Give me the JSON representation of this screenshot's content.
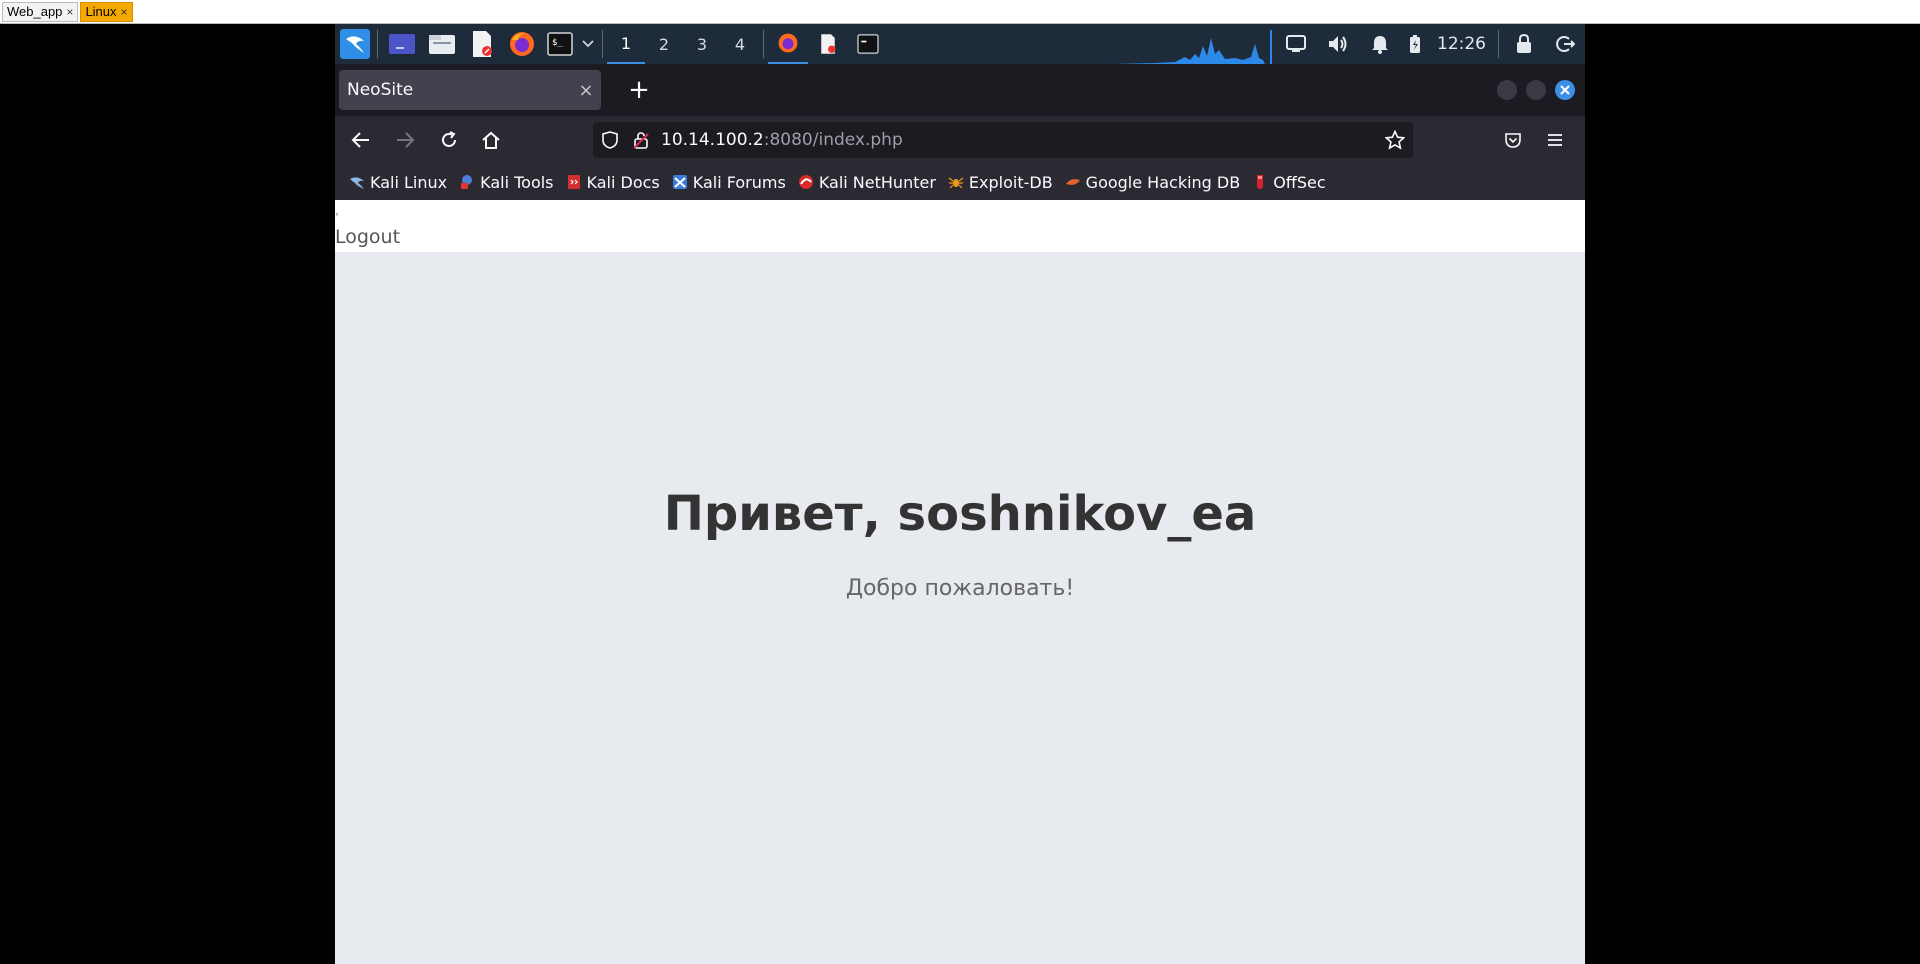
{
  "outer_tabs": [
    {
      "label": "Web_app",
      "close": "×"
    },
    {
      "label": "Linux",
      "close": "×"
    }
  ],
  "panel": {
    "workspaces": [
      "1",
      "2",
      "3",
      "4"
    ],
    "active_workspace": "1",
    "clock": "12:26",
    "icons": [
      "kali-menu-icon",
      "terminal-launcher-icon",
      "file-manager-icon",
      "text-editor-icon",
      "firefox-icon",
      "terminal-icon",
      "chevron-down-icon",
      "firefox-window-icon",
      "editor-window-icon",
      "terminal-window-icon",
      "network-monitor-icon",
      "display-icon",
      "volume-icon",
      "notification-bell-icon",
      "battery-icon",
      "lock-icon",
      "logout-icon"
    ],
    "accent": "#3d8fe6"
  },
  "browser": {
    "tab_title": "NeoSite",
    "tab_close": "×",
    "new_tab": "+",
    "url_host": "10.14.100.2",
    "url_path": ":8080/index.php",
    "bookmarks": [
      "Kali Linux",
      "Kali Tools",
      "Kali Docs",
      "Kali Forums",
      "Kali NetHunter",
      "Exploit-DB",
      "Google Hacking DB",
      "OffSec"
    ]
  },
  "page": {
    "logout": "Logout",
    "tiny_mark": "°",
    "greeting": "Привет, soshnikov_ea",
    "welcome": "Добро пожаловать!"
  }
}
